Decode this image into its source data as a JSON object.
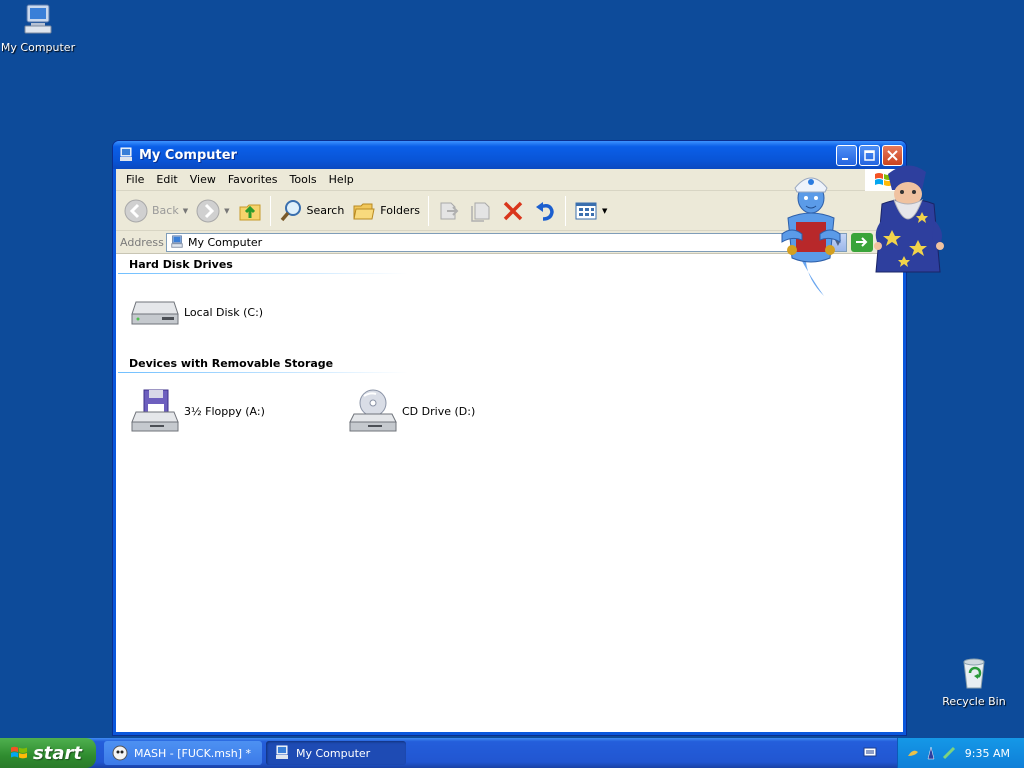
{
  "desktop": {
    "icons": [
      {
        "label": "My Computer",
        "icon": "my-computer-icon"
      },
      {
        "label": "Recycle Bin",
        "icon": "recycle-bin-icon"
      }
    ]
  },
  "window": {
    "title": "My Computer",
    "menu": [
      "File",
      "Edit",
      "View",
      "Favorites",
      "Tools",
      "Help"
    ],
    "toolbar": {
      "back": "Back",
      "search": "Search",
      "folders": "Folders"
    },
    "address": {
      "label": "Address",
      "value": "My Computer"
    },
    "groups": [
      {
        "header": "Hard Disk Drives",
        "items": [
          {
            "label": "Local Disk (C:)",
            "icon": "hard-disk-icon"
          }
        ]
      },
      {
        "header": "Devices with Removable Storage",
        "items": [
          {
            "label": "3½ Floppy (A:)",
            "icon": "floppy-drive-icon"
          },
          {
            "label": "CD Drive (D:)",
            "icon": "cd-drive-icon"
          }
        ]
      }
    ]
  },
  "taskbar": {
    "start_label": "start",
    "tasks": [
      {
        "label": "MASH - [FUCK.msh] *",
        "active": false
      },
      {
        "label": "My Computer",
        "active": true
      }
    ],
    "clock": "9:35 AM"
  },
  "colors": {
    "desktop": "#0d4b9a",
    "title_blue": "#0a57dc",
    "start_green": "#3c9a3c"
  }
}
